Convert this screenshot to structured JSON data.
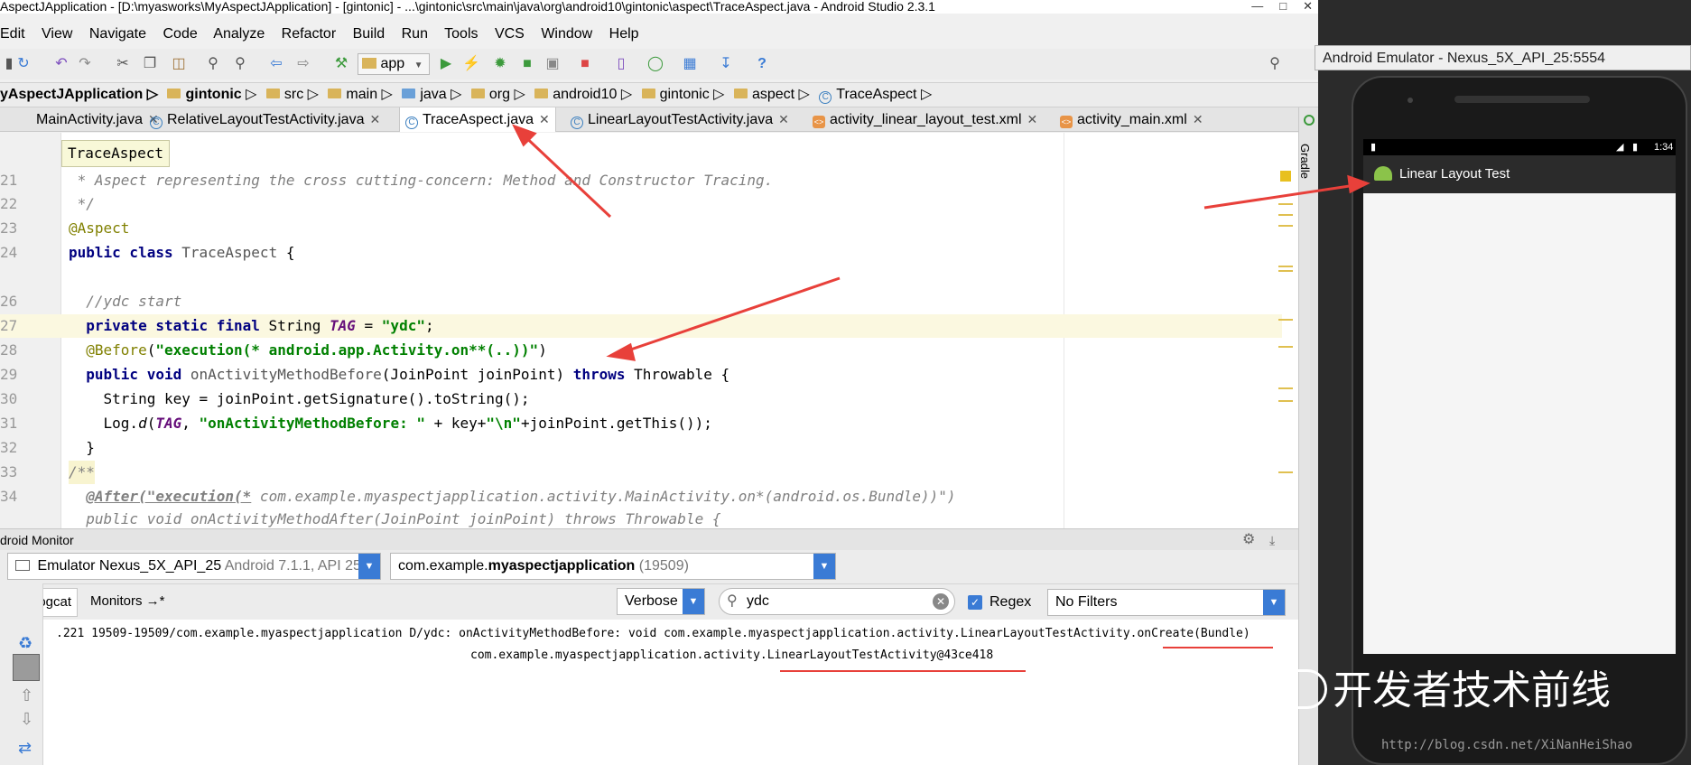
{
  "window": {
    "title": "AspectJApplication - [D:\\myasworks\\MyAspectJApplication] - [gintonic] - ...\\gintonic\\src\\main\\java\\org\\android10\\gintonic\\aspect\\TraceAspect.java - Android Studio 2.3.1"
  },
  "menu": [
    "Edit",
    "View",
    "Navigate",
    "Code",
    "Analyze",
    "Refactor",
    "Build",
    "Run",
    "Tools",
    "VCS",
    "Window",
    "Help"
  ],
  "toolbar": {
    "run_config": "app"
  },
  "breadcrumbs": [
    "yAspectJApplication",
    "gintonic",
    "src",
    "main",
    "java",
    "org",
    "android10",
    "gintonic",
    "aspect",
    "TraceAspect"
  ],
  "tabs": [
    {
      "label": "MainActivity.java",
      "kind": "class"
    },
    {
      "label": "RelativeLayoutTestActivity.java",
      "kind": "class"
    },
    {
      "label": "TraceAspect.java",
      "kind": "class",
      "active": true
    },
    {
      "label": "LinearLayoutTestActivity.java",
      "kind": "class"
    },
    {
      "label": "activity_linear_layout_test.xml",
      "kind": "xml"
    },
    {
      "label": "activity_main.xml",
      "kind": "xml"
    }
  ],
  "editor": {
    "tooltip": "TraceAspect",
    "line_numbers": [
      "21",
      "22",
      "23",
      "24",
      "",
      "26",
      "27",
      "28",
      "29",
      "30",
      "31",
      "32",
      "33",
      "34"
    ]
  },
  "monitor": {
    "title": "droid Monitor",
    "device_name": "Emulator Nexus_5X_API_25",
    "device_detail": "Android 7.1.1, API 25",
    "process_prefix": "com.example.",
    "process_bold": "myaspectjapplication",
    "process_pid": "(19509)",
    "tab_logcat": "logcat",
    "tab_monitors": "Monitors →*",
    "log_level": "Verbose",
    "search_value": "ydc",
    "regex_label": "Regex",
    "filter_option": "No Filters",
    "log_line_1": ".221 19509-19509/com.example.myaspectjapplication D/ydc: onActivityMethodBefore: void com.example.myaspectjapplication.activity.LinearLayoutTestActivity.onCreate(Bundle)",
    "log_line_2": "com.example.myaspectjapplication.activity.LinearLayoutTestActivity@43ce418"
  },
  "side_panel": {
    "gradle_label": "Gradle"
  },
  "emulator": {
    "title": "Android Emulator - Nexus_5X_API_25:5554",
    "status_time": "1:34",
    "app_title": "Linear Layout Test"
  },
  "watermark": {
    "brand": "开发者技术前线",
    "url": "http://blog.csdn.net/XiNanHeiShao"
  },
  "colors": {
    "keyword": "#000080",
    "string": "#008000",
    "annotation": "#808000",
    "arrow": "#e8403a",
    "accent_blue": "#3a7bd5"
  }
}
